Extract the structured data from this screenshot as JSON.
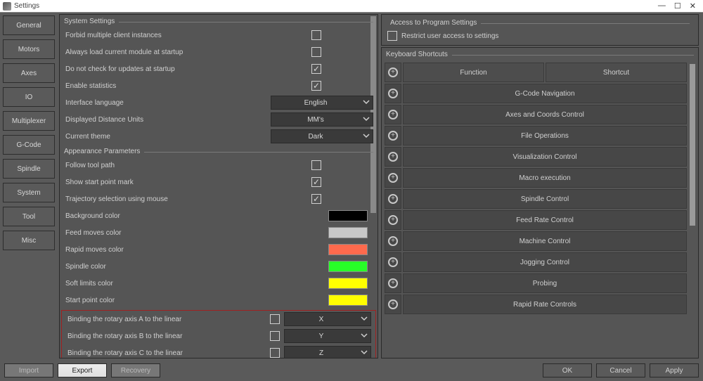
{
  "window": {
    "title": "Settings"
  },
  "sidebar": {
    "items": [
      {
        "label": "General"
      },
      {
        "label": "Motors"
      },
      {
        "label": "Axes"
      },
      {
        "label": "IO"
      },
      {
        "label": "Multiplexer"
      },
      {
        "label": "G-Code"
      },
      {
        "label": "Spindle"
      },
      {
        "label": "System"
      },
      {
        "label": "Tool"
      },
      {
        "label": "Misc"
      }
    ]
  },
  "system_settings": {
    "section_title": "System Settings",
    "rows": [
      {
        "label": "Forbid multiple client instances",
        "checked": false
      },
      {
        "label": "Always load current module at startup",
        "checked": false
      },
      {
        "label": "Do not check for updates at startup",
        "checked": true
      },
      {
        "label": "Enable statistics",
        "checked": true
      }
    ],
    "selects": [
      {
        "label": "Interface language",
        "value": "English"
      },
      {
        "label": "Displayed Distance Units",
        "value": "MM's"
      },
      {
        "label": "Current theme",
        "value": "Dark"
      }
    ]
  },
  "appearance": {
    "section_title": "Appearance Parameters",
    "check_rows": [
      {
        "label": "Follow tool path",
        "checked": false
      },
      {
        "label": "Show start point mark",
        "checked": true
      },
      {
        "label": "Trajectory selection using mouse",
        "checked": true
      }
    ],
    "color_rows": [
      {
        "label": "Background color",
        "color": "#000000"
      },
      {
        "label": "Feed moves color",
        "color": "#c8c8c8"
      },
      {
        "label": "Rapid moves color",
        "color": "#ff6a4d"
      },
      {
        "label": "Spindle color",
        "color": "#28ff28"
      },
      {
        "label": "Soft limits color",
        "color": "#ffff00"
      },
      {
        "label": "Start point color",
        "color": "#ffff00"
      }
    ],
    "binding_rows": [
      {
        "label": "Binding the rotary axis A to the linear",
        "value": "X"
      },
      {
        "label": "Binding the rotary axis B to the linear",
        "value": "Y"
      },
      {
        "label": "Binding the rotary axis C to the linear",
        "value": "Z"
      }
    ]
  },
  "access": {
    "section_title": "Access to Program Settings",
    "checkbox_label": "Restrict user access to settings"
  },
  "shortcuts": {
    "section_title": "Keyboard Shortcuts",
    "header_function": "Function",
    "header_shortcut": "Shortcut",
    "categories": [
      {
        "label": "G-Code Navigation"
      },
      {
        "label": "Axes and Coords Control"
      },
      {
        "label": "File Operations"
      },
      {
        "label": "Visualization Control"
      },
      {
        "label": "Macro execution"
      },
      {
        "label": "Spindle Control"
      },
      {
        "label": "Feed Rate Control"
      },
      {
        "label": "Machine Control"
      },
      {
        "label": "Jogging Control"
      },
      {
        "label": "Probing"
      },
      {
        "label": "Rapid Rate Controls"
      }
    ]
  },
  "footer": {
    "import": "Import",
    "export": "Export",
    "recovery": "Recovery",
    "ok": "OK",
    "cancel": "Cancel",
    "apply": "Apply"
  }
}
